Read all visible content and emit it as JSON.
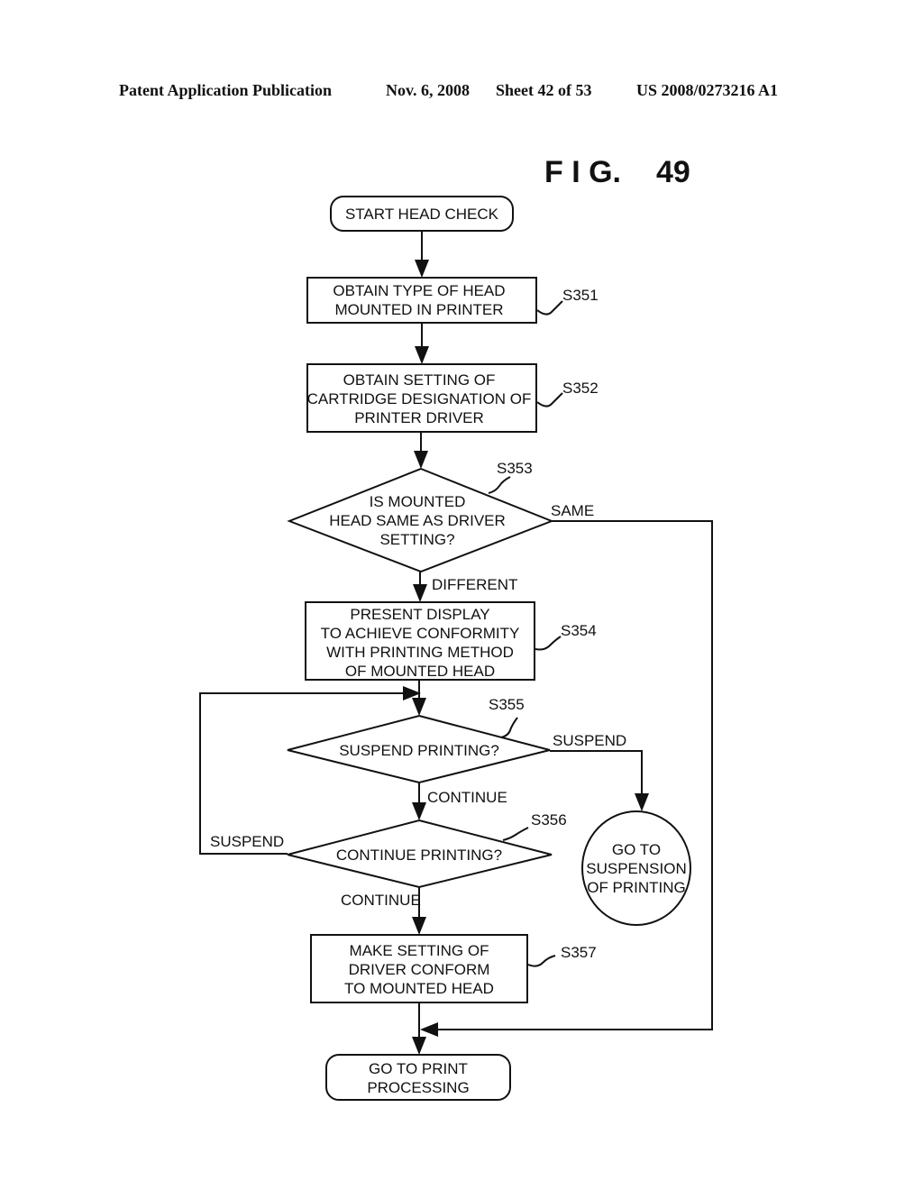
{
  "header": {
    "publication": "Patent Application Publication",
    "date": "Nov. 6, 2008",
    "sheet": "Sheet 42 of 53",
    "number": "US 2008/0273216 A1"
  },
  "figure": {
    "label": "F I G.",
    "number": "49"
  },
  "nodes": {
    "start": {
      "lines": [
        "START HEAD CHECK"
      ]
    },
    "s351": {
      "id": "S351",
      "lines": [
        "OBTAIN TYPE OF HEAD",
        "MOUNTED IN PRINTER"
      ]
    },
    "s352": {
      "id": "S352",
      "lines": [
        "OBTAIN SETTING OF",
        "CARTRIDGE DESIGNATION OF",
        "PRINTER DRIVER"
      ]
    },
    "s353": {
      "id": "S353",
      "lines": [
        "IS MOUNTED",
        "HEAD SAME AS DRIVER",
        "SETTING?"
      ]
    },
    "s354": {
      "id": "S354",
      "lines": [
        "PRESENT DISPLAY",
        "TO ACHIEVE CONFORMITY",
        "WITH PRINTING METHOD",
        "OF MOUNTED HEAD"
      ]
    },
    "s355": {
      "id": "S355",
      "lines": [
        "SUSPEND PRINTING?"
      ]
    },
    "s356": {
      "id": "S356",
      "lines": [
        "CONTINUE PRINTING?"
      ]
    },
    "s357": {
      "id": "S357",
      "lines": [
        "MAKE SETTING OF",
        "DRIVER CONFORM",
        "TO MOUNTED HEAD"
      ]
    },
    "suspension": {
      "lines": [
        "GO TO",
        "SUSPENSION",
        "OF PRINTING"
      ]
    },
    "end": {
      "lines": [
        "GO TO PRINT",
        "PROCESSING"
      ]
    }
  },
  "edge_labels": {
    "same": "SAME",
    "different": "DIFFERENT",
    "suspend_s355": "SUSPEND",
    "continue_s355": "CONTINUE",
    "suspend_s356": "SUSPEND",
    "continue_s356": "CONTINUE"
  }
}
